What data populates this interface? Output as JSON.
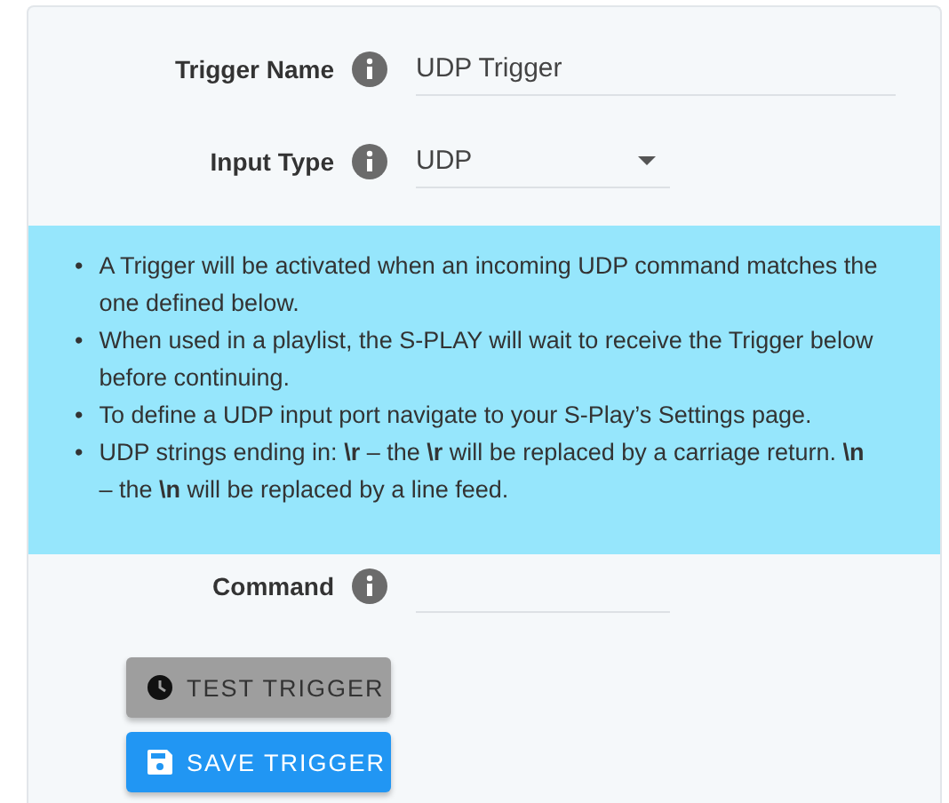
{
  "fields": [
    {
      "kind": "text",
      "label": "Trigger Name",
      "value": "UDP Trigger",
      "wide": true
    },
    {
      "kind": "select",
      "label": "Input Type",
      "value": "UDP",
      "wide": false
    }
  ],
  "info": [
    {
      "bullet": "•",
      "text": "A Trigger will be activated when an incoming UDP command matches the one defined below."
    },
    {
      "bullet": "•",
      "text": "When used in a playlist, the S-PLAY will wait to receive the Trigger below before continuing."
    },
    {
      "bullet": "•",
      "text": "To define a UDP input port navigate to your S-Play’s Settings page."
    },
    {
      "bullet": "•",
      "text": "UDP strings ending in: **\\r** – the **\\r** will be replaced by a carriage return. **\\n** – the **\\n** will be replaced by a line feed."
    }
  ],
  "command": {
    "kind": "text",
    "label": "Command",
    "wide": false
  },
  "buttons": [
    {
      "kind": "test",
      "label": "TEST TRIGGER",
      "disabled": true
    },
    {
      "kind": "save",
      "label": "SAVE TRIGGER",
      "disabled": false
    }
  ]
}
